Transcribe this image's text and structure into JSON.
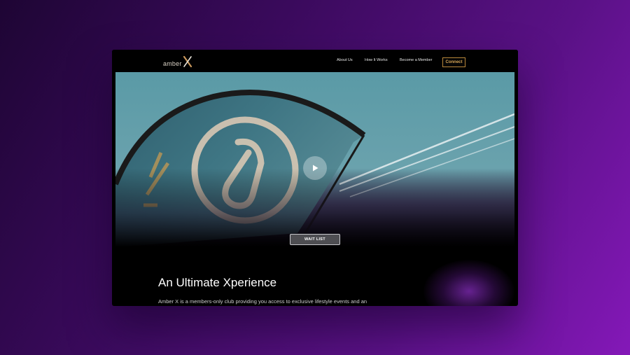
{
  "site": {
    "logo_text": "amber",
    "logo_mark": "X"
  },
  "nav": {
    "items": [
      {
        "label": "About Us"
      },
      {
        "label": "How It Works"
      },
      {
        "label": "Become a Member"
      }
    ],
    "connect_label": "Connect"
  },
  "hero": {
    "play_icon": "play-icon",
    "cta_label": "WAIT LIST"
  },
  "intro": {
    "heading": "An Ultimate Xperience",
    "text": "Amber X is a members-only club providing you access to exclusive lifestyle events and an"
  },
  "colors": {
    "accent": "#d6a556",
    "background_start": "#1e0534",
    "background_end": "#8418b8",
    "sky": "#5f9eaa"
  }
}
